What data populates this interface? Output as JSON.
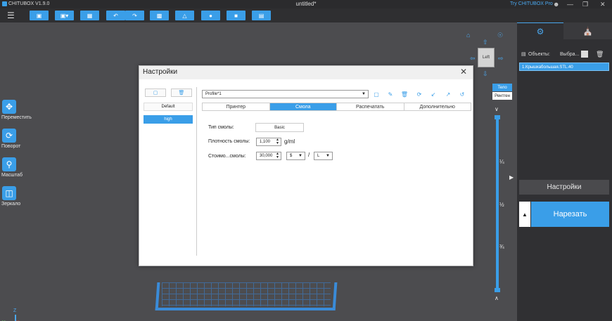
{
  "app": {
    "name": "CHITUBOX V1.9.0",
    "document": "untitled*",
    "try_pro": "Try CHITUBOX Pro"
  },
  "viewport": {
    "tools": [
      "Переместить",
      "Поворот",
      "Масштаб",
      "Зеркало"
    ],
    "cube_face": "Left",
    "view_modes": {
      "solid": "Тело",
      "xray": "Рентген"
    },
    "slider_marks": [
      "¼",
      "½",
      "¾"
    ]
  },
  "right_panel": {
    "objects_label": "Объекты:",
    "select_label": "Выбра...",
    "object_item": "1.Крышкабольшая.STL.40",
    "settings_button": "Настройки",
    "slice_button": "Нарезать"
  },
  "dialog": {
    "title": "Настройки",
    "profiles": [
      "Default",
      "high"
    ],
    "selected_profile": "high",
    "profile_select": "Profile*1",
    "tabs": [
      "Принтер",
      "Смола",
      "Распечатать",
      "Дополнительно"
    ],
    "active_tab": "Смола",
    "resin_type_label": "Тип смолы:",
    "resin_type_value": "Basic",
    "density_label": "Плотность смолы:",
    "density_value": "1,100",
    "density_unit": "g/ml",
    "cost_label": "Стоимо...смолы:",
    "cost_value": "30,000",
    "currency": "$",
    "separator": "/",
    "volume_unit": "L"
  },
  "colors": {
    "accent": "#3a9ee8",
    "background": "#4a4a4d",
    "panel": "#303033"
  }
}
